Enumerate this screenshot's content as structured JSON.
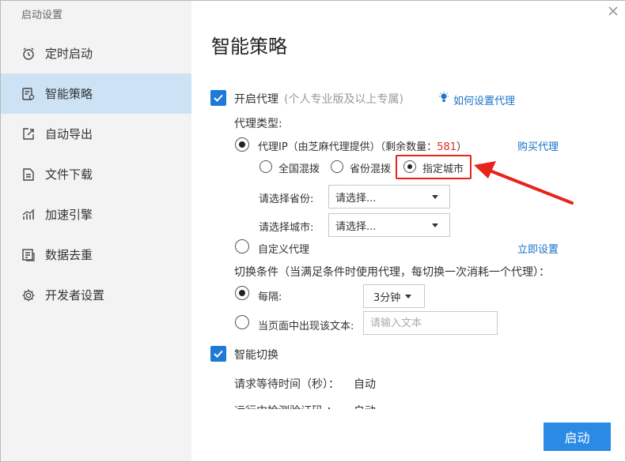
{
  "window": {
    "title": "启动设置"
  },
  "sidebar": {
    "items": [
      {
        "label": "定时启动",
        "icon": "alarm-clock-icon"
      },
      {
        "label": "智能策略",
        "icon": "strategy-icon",
        "active": true
      },
      {
        "label": "自动导出",
        "icon": "export-icon"
      },
      {
        "label": "文件下载",
        "icon": "file-download-icon"
      },
      {
        "label": "加速引擎",
        "icon": "speed-chart-icon"
      },
      {
        "label": "数据去重",
        "icon": "dedupe-icon"
      },
      {
        "label": "开发者设置",
        "icon": "gear-icon"
      }
    ]
  },
  "main": {
    "title": "智能策略",
    "proxy": {
      "enable_label": "开启代理",
      "enable_note": "(个人专业版及以上专属)",
      "help_link": "如何设置代理",
      "type_label": "代理类型:",
      "ip_option_label": "代理IP（由芝麻代理提供）（剩余数量：",
      "remaining_count": "581",
      "ip_option_suffix": "）",
      "buy_link": "购买代理",
      "scope_options": [
        "全国混拨",
        "省份混拨",
        "指定城市"
      ],
      "selected_scope": "指定城市",
      "province_label": "请选择省份:",
      "province_value": "请选择...",
      "city_label": "请选择城市:",
      "city_value": "请选择...",
      "custom_label": "自定义代理",
      "setup_link": "立即设置"
    },
    "switch": {
      "condition_label": "切换条件（当满足条件时使用代理，每切换一次消耗一个代理）：",
      "interval_label": "每隔:",
      "interval_value": "3分钟",
      "text_label": "当页面中出现该文本:",
      "text_placeholder": "请输入文本"
    },
    "smart_switch": {
      "label": "智能切换",
      "wait_label": "请求等待时间（秒）：",
      "wait_value": "自动",
      "captcha_label": "运行中检测验证码 ：",
      "captcha_value": "自动"
    },
    "start_button": "启动"
  },
  "colors": {
    "accent": "#1e7ad6",
    "button": "#2b8ae6",
    "sidebar_bg": "#f3f3f3",
    "active_bg": "#cde3f5",
    "annotation": "#e8231b",
    "count": "#e0301e"
  }
}
